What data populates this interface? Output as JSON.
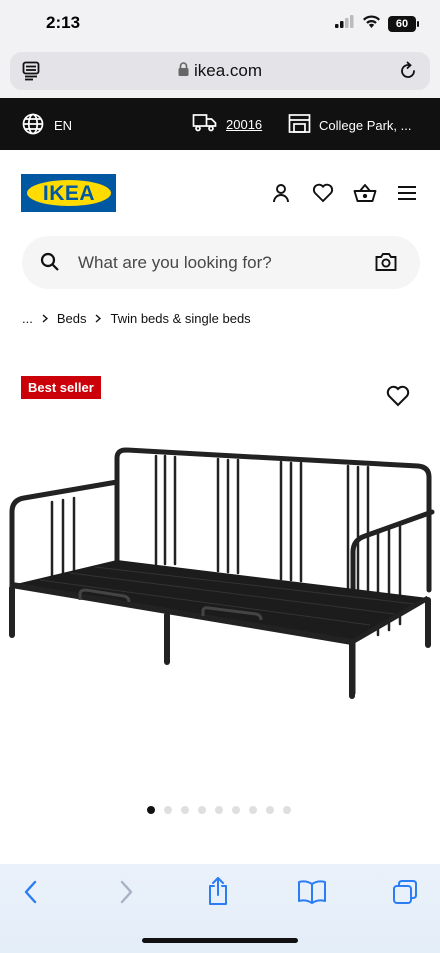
{
  "status_bar": {
    "time": "2:13",
    "battery": "60",
    "icons": [
      "signal-icon",
      "wifi-icon",
      "battery-icon"
    ]
  },
  "browser": {
    "url": "ikea.com",
    "icons": [
      "reader-icon",
      "lock-icon",
      "reload-icon"
    ]
  },
  "top_strip": {
    "language": "EN",
    "zip": "20016",
    "store": "College Park, ..."
  },
  "header": {
    "logo_text": "IKEA",
    "icons": [
      "account-icon",
      "heart-icon",
      "basket-icon",
      "menu-icon"
    ],
    "colors": {
      "logo_blue": "#0058a3",
      "logo_yellow": "#ffdb00"
    }
  },
  "search": {
    "placeholder": "What are you looking for?",
    "value": ""
  },
  "breadcrumb": {
    "items": [
      "...",
      "Beds",
      "Twin beds & single beds"
    ]
  },
  "product": {
    "badge": "Best seller",
    "badge_color": "#cc0008",
    "image_icon": "daybed-frame-image",
    "gallery_total": 9,
    "gallery_active_index": 0
  },
  "toolbar": {
    "icons": [
      "back-icon",
      "forward-icon",
      "share-icon",
      "bookmarks-icon",
      "tabs-icon"
    ]
  }
}
